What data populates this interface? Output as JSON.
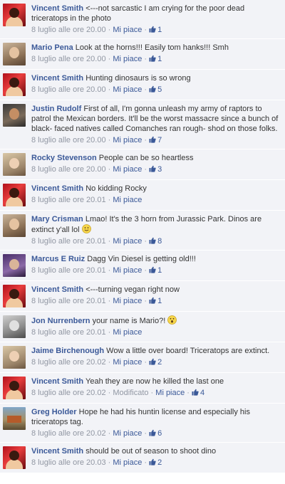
{
  "colors": {
    "author": "#3b5998",
    "meta": "#9197a3",
    "row_bg": "#f2f3f7"
  },
  "labels": {
    "like": "Mi piace",
    "modified": "Modificato",
    "sep": "·"
  },
  "comments": [
    {
      "author": "Vincent Smith",
      "text": "<---not sarcastic I am crying for the poor dead triceratops in the photo",
      "time": "8 luglio alle ore 20.00",
      "likes": "1",
      "avatar": "red-hat-avatar"
    },
    {
      "author": "Mario Pena",
      "text": "Look at the horns!!! Easily tom hanks!!! Smh",
      "time": "8 luglio alle ore 20.00",
      "likes": "1",
      "avatar": "selfie-avatar"
    },
    {
      "author": "Vincent Smith",
      "text": "Hunting dinosaurs is so wrong",
      "time": "8 luglio alle ore 20.00",
      "likes": "5",
      "avatar": "red-hat-avatar"
    },
    {
      "author": "Justin Rudolf",
      "text": "First of all, I'm gonna unleash my army of raptors to patrol the Mexican borders. It'll be the worst massacre since a bunch of black- faced natives called Comanches ran rough- shod on those folks.",
      "time": "8 luglio alle ore 20.00",
      "likes": "7",
      "avatar": "man-avatar"
    },
    {
      "author": "Rocky Stevenson",
      "text": "People can be so heartless",
      "time": "8 luglio alle ore 20.00",
      "likes": "3",
      "avatar": "couple-avatar"
    },
    {
      "author": "Vincent Smith",
      "text": "No kidding Rocky",
      "time": "8 luglio alle ore 20.01",
      "likes": "",
      "avatar": "red-hat-avatar"
    },
    {
      "author": "Mary Crisman",
      "text": "Lmao! It's the 3 horn from Jurassic Park. Dinos are extinct y'all lol",
      "emoji": "smile",
      "time": "8 luglio alle ore 20.01",
      "likes": "8",
      "avatar": "woman-avatar"
    },
    {
      "author": "Marcus E Ruiz",
      "text": "Dagg Vin Diesel is getting old!!!",
      "time": "8 luglio alle ore 20.01",
      "likes": "1",
      "avatar": "purple-avatar"
    },
    {
      "author": "Vincent Smith",
      "text": "<---turning vegan right now",
      "time": "8 luglio alle ore 20.01",
      "likes": "1",
      "avatar": "red-hat-avatar"
    },
    {
      "author": "Jon Nurrenbern",
      "text": "your name is Mario?!",
      "emoji": "surprised",
      "time": "8 luglio alle ore 20.01",
      "likes": "",
      "avatar": "bw-avatar"
    },
    {
      "author": "Jaime Birchenough",
      "text": "Wow a little over board! Triceratops are extinct.",
      "time": "8 luglio alle ore 20.02",
      "likes": "2",
      "avatar": "family-avatar"
    },
    {
      "author": "Vincent Smith",
      "text": "Yeah they are now he killed the last one",
      "time": "8 luglio alle ore 20.02",
      "modified": true,
      "likes": "4",
      "avatar": "red-hat-avatar"
    },
    {
      "author": "Greg Holder",
      "text": "Hope he had his huntin license and especially his triceratops tag.",
      "time": "8 luglio alle ore 20.02",
      "likes": "6",
      "avatar": "outdoor-avatar"
    },
    {
      "author": "Vincent Smith",
      "text": "should be out of season to shoot dino",
      "time": "8 luglio alle ore 20.03",
      "likes": "2",
      "avatar": "red-hat-avatar"
    }
  ]
}
